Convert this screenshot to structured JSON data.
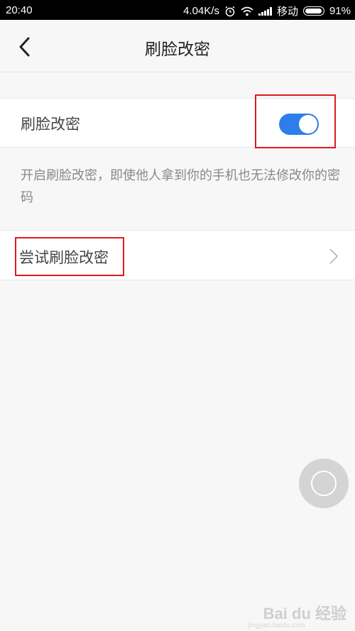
{
  "status_bar": {
    "time": "20:40",
    "speed": "4.04K/s",
    "carrier": "移动",
    "battery": "91%"
  },
  "header": {
    "title": "刷脸改密"
  },
  "toggle_row": {
    "label": "刷脸改密",
    "enabled": true,
    "accent_color": "#2d7ee8"
  },
  "hint": {
    "text": "开启刷脸改密，即使他人拿到你的手机也无法修改你的密码"
  },
  "try_row": {
    "label": "尝试刷脸改密"
  },
  "icons": {
    "back": "chevron-left-icon",
    "row_chevron": "chevron-right-icon",
    "assistive": "assistive-touch-icon",
    "alarm": "alarm-icon",
    "wifi": "wifi-icon",
    "signal": "signal-icon",
    "battery": "battery-icon"
  },
  "annotation_color": "#e0191c",
  "watermark": {
    "logo": "Bai du 经验",
    "url": "jingyan.baidu.com"
  }
}
